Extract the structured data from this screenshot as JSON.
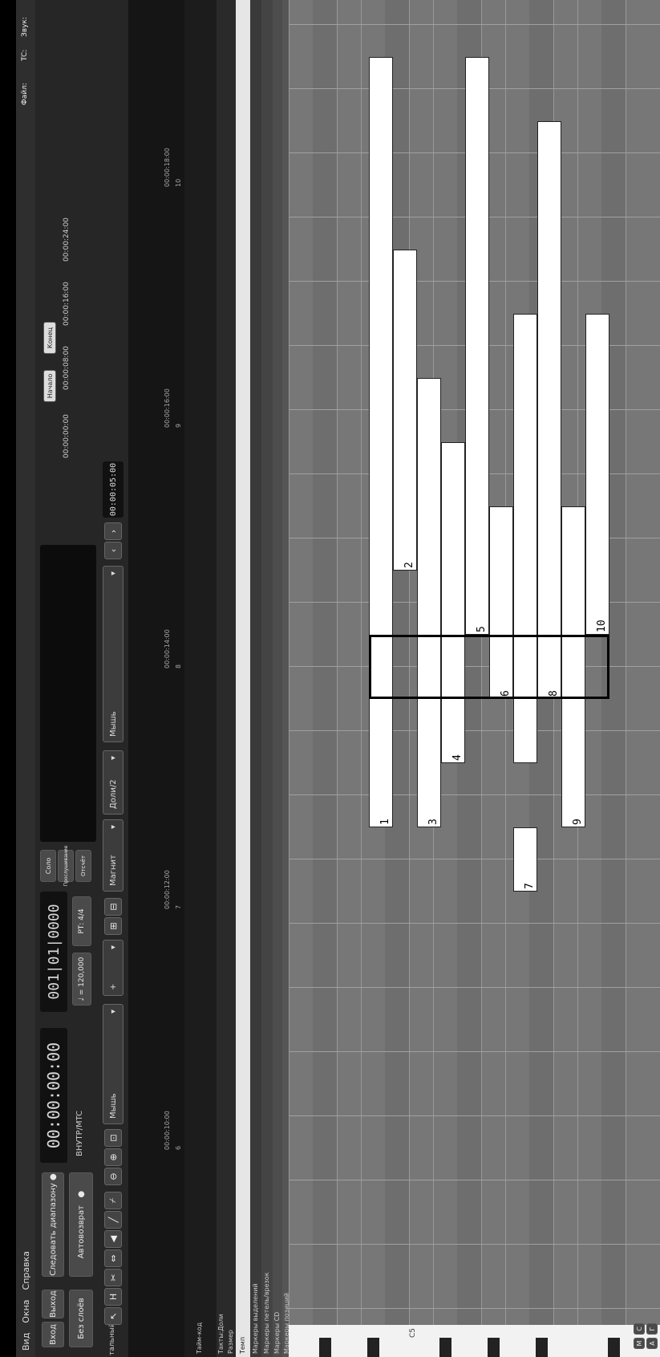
{
  "menu": [
    "Вид",
    "Окна",
    "Справка"
  ],
  "buttons": {
    "vhod": "Вход",
    "vyhod": "Выход",
    "bez_sloev": "Без слоёв",
    "follow_range": "Следовать диапазону",
    "autoreturn": "Автовозврат",
    "internal": "ВНУТР/MTC",
    "solo": "Соло",
    "preroll": "Прослушивание",
    "count_in": "Отсчёт",
    "tempo": "♩ = 120,000",
    "meter": "РТ: 4/4",
    "mode_label": "тальный"
  },
  "clock": {
    "timecode": "00:00:00:00",
    "bbt": "001|01|0000"
  },
  "info": {
    "file": "Файл:",
    "tc": "TC:",
    "sound": "Звук:"
  },
  "toolbar": {
    "mouse_left": "Мышь",
    "mouse_right": "Мышь",
    "snap": "Магнит",
    "grid": "Доли/2",
    "nudge": "00:00:05:00",
    "plus": "+"
  },
  "mini_timeline": {
    "start": "Начало",
    "end": "Конец",
    "times": [
      "00:00:00:00",
      "00:00:08:00",
      "00:00:16:00",
      "00:00:24:00"
    ]
  },
  "ruler": {
    "times": [
      "00:00:10:00",
      "00:00:12:00",
      "00:00:14:00",
      "00:00:16:00",
      "00:00:18:00"
    ],
    "bars": [
      "6",
      "7",
      "8",
      "9",
      "10"
    ]
  },
  "track_labels": [
    "Тайм-код",
    "Такты:Доли",
    "Размер",
    "Темп",
    "Маркеры выделений",
    "Маркеры петель/врезок",
    "Маркеры CD",
    "Маркеры позиций"
  ],
  "left_buttons": [
    "М",
    "С",
    "А",
    "Г"
  ],
  "key_label": "C5",
  "notes": [
    {
      "row": 0,
      "start": 4,
      "len": 12,
      "label": "1"
    },
    {
      "row": 1,
      "start": 8,
      "len": 5,
      "label": "2"
    },
    {
      "row": 2,
      "start": 4,
      "len": 7,
      "label": "3"
    },
    {
      "row": 3,
      "start": 5,
      "len": 5,
      "label": "4"
    },
    {
      "row": 4,
      "start": 7,
      "len": 9,
      "label": "5"
    },
    {
      "row": 5,
      "start": 6,
      "len": 3,
      "label": "6"
    },
    {
      "row": 6,
      "start": 3,
      "len": 1,
      "label": "7"
    },
    {
      "row": 6,
      "start": 5,
      "len": 7,
      "label": ""
    },
    {
      "row": 7,
      "start": 6,
      "len": 9,
      "label": "8"
    },
    {
      "row": 8,
      "start": 4,
      "len": 5,
      "label": "9"
    },
    {
      "row": 9,
      "start": 7,
      "len": 5,
      "label": "10"
    }
  ]
}
